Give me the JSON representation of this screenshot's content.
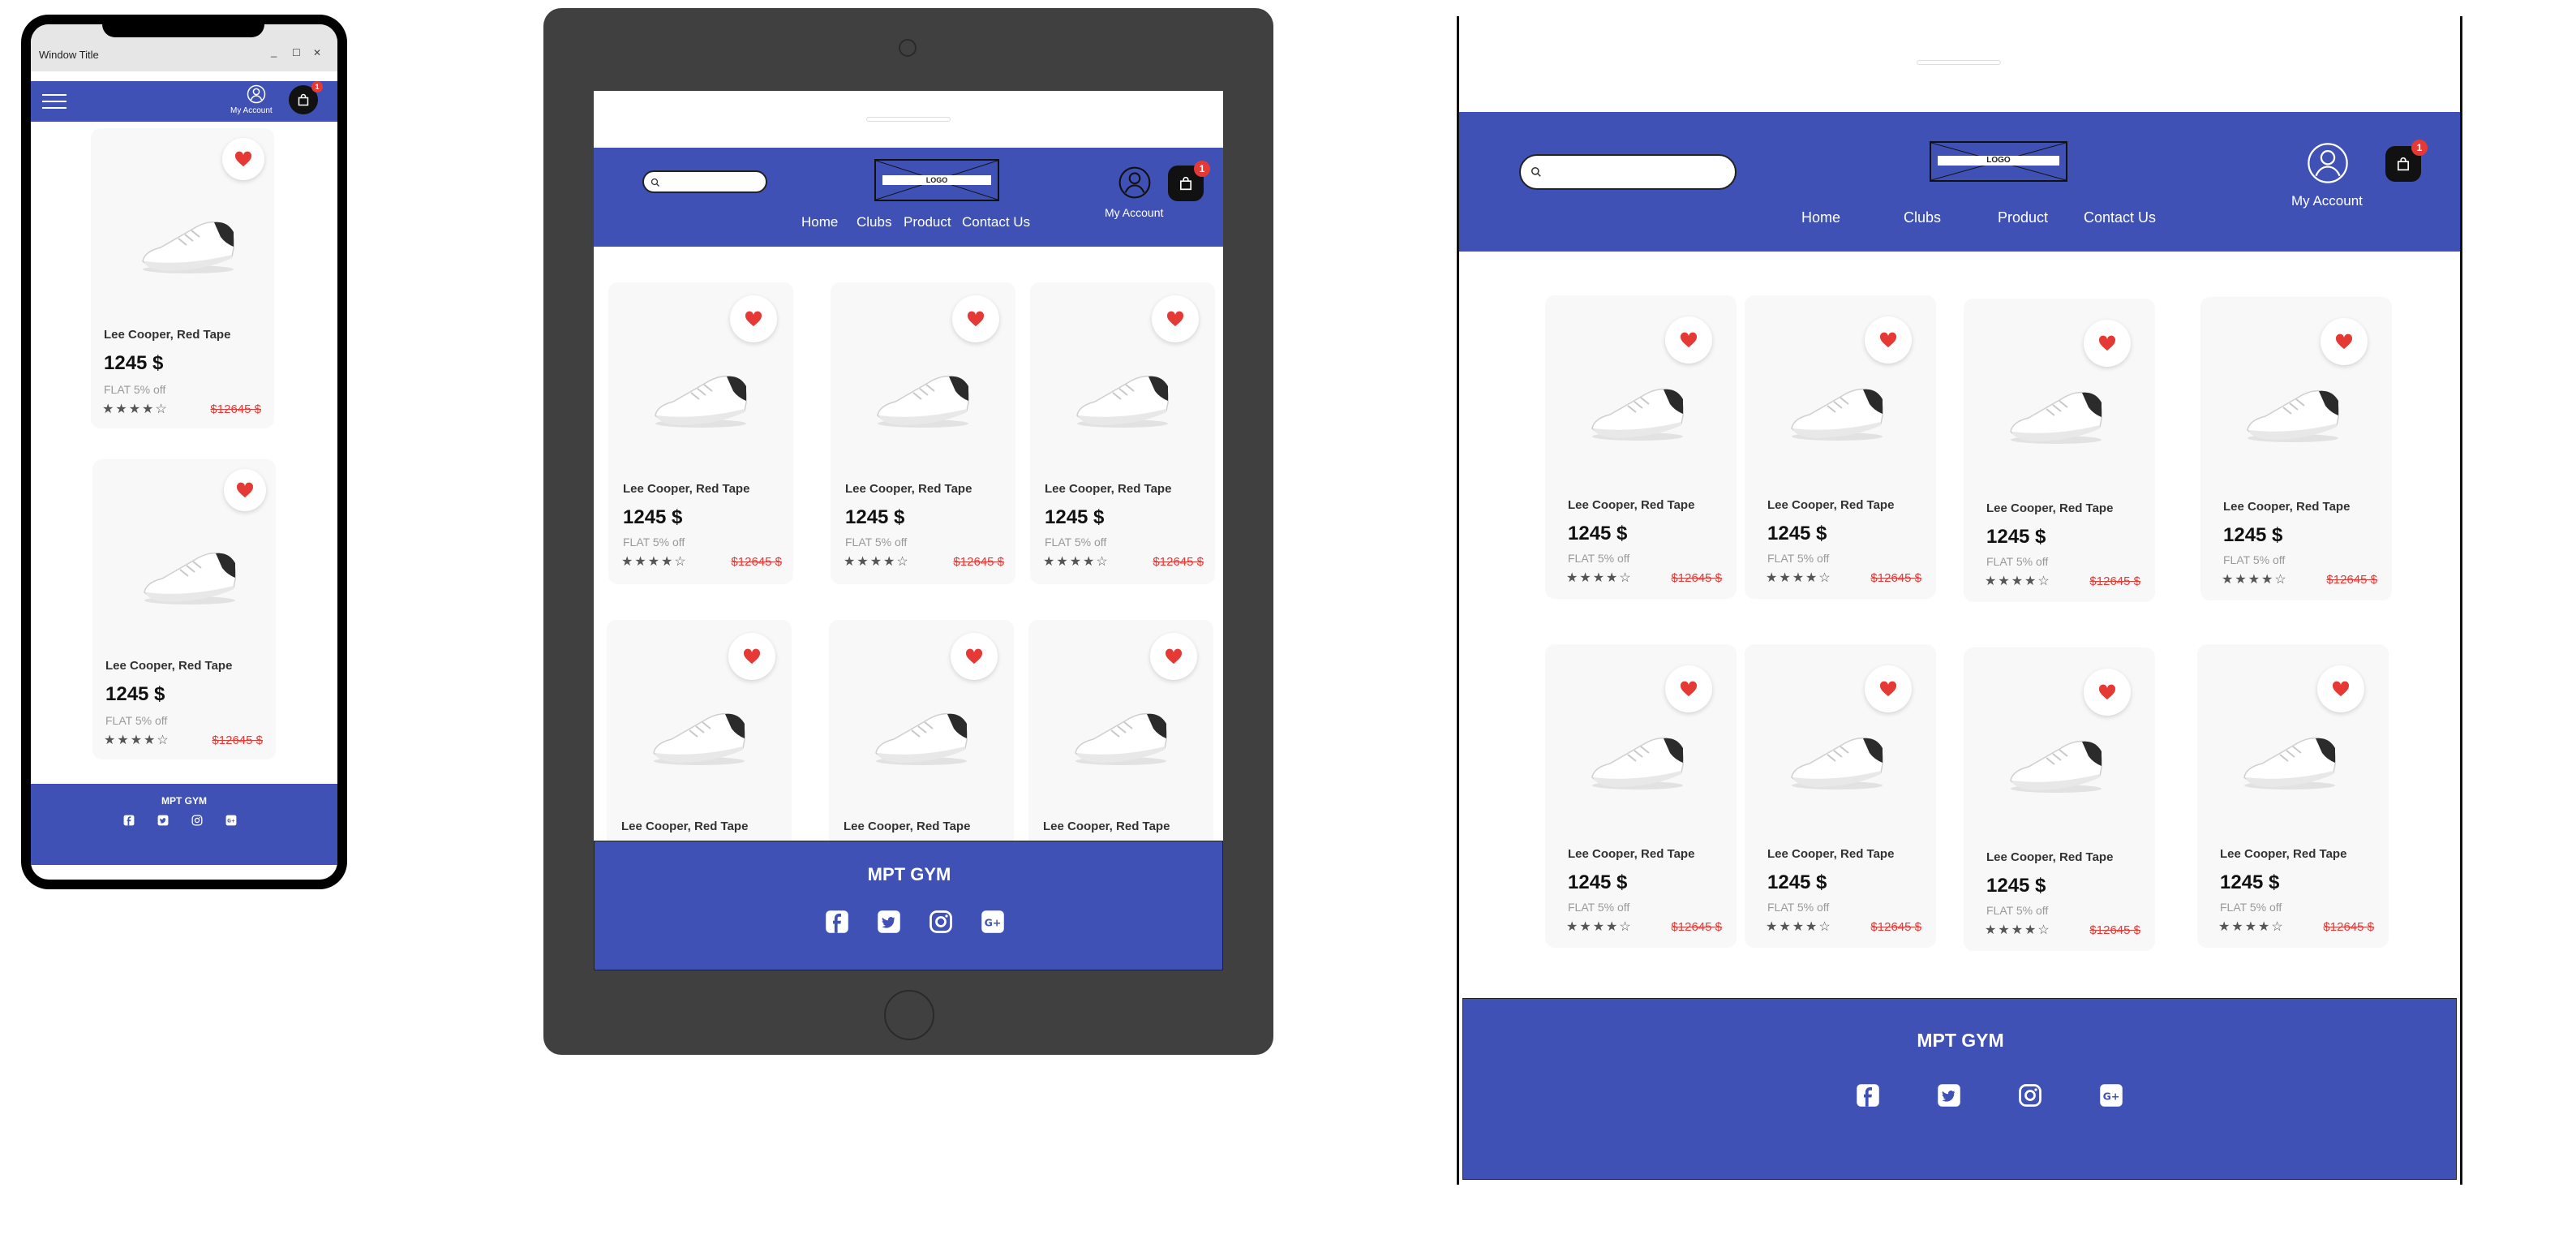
{
  "colors": {
    "brand": "#3f51b5",
    "heart": "#e53935",
    "strike_price": "#e53935",
    "tablet_frame": "#404040"
  },
  "mobile": {
    "window_title": "Window Title",
    "window_controls": [
      "_",
      "☐",
      "✕"
    ],
    "account_label": "My Account",
    "cart_badge": "1",
    "footer_title": "MPT GYM",
    "products": [
      {
        "name": "Lee Cooper, Red Tape",
        "price": "1245 $",
        "offer": "FLAT 5% off",
        "old_price": "$12645 $",
        "rating": 4
      },
      {
        "name": "Lee Cooper, Red Tape",
        "price": "1245 $",
        "offer": "FLAT 5% off",
        "old_price": "$12645 $",
        "rating": 4
      }
    ]
  },
  "tablet": {
    "logo_text": "LOGO",
    "account_label": "My Account",
    "cart_badge": "1",
    "nav": [
      "Home",
      "Clubs",
      "Product",
      "Contact Us"
    ],
    "footer_title": "MPT GYM",
    "products": [
      {
        "name": "Lee Cooper, Red Tape",
        "price": "1245 $",
        "offer": "FLAT 5% off",
        "old_price": "$12645 $",
        "rating": 4
      },
      {
        "name": "Lee Cooper, Red Tape",
        "price": "1245 $",
        "offer": "FLAT 5% off",
        "old_price": "$12645 $",
        "rating": 4
      },
      {
        "name": "Lee Cooper, Red Tape",
        "price": "1245 $",
        "offer": "FLAT 5% off",
        "old_price": "$12645 $",
        "rating": 4
      },
      {
        "name": "Lee Cooper, Red Tape"
      },
      {
        "name": "Lee Cooper, Red Tape"
      },
      {
        "name": "Lee Cooper, Red Tape"
      }
    ]
  },
  "desktop": {
    "logo_text": "LOGO",
    "account_label": "My Account",
    "cart_badge": "1",
    "nav": [
      "Home",
      "Clubs",
      "Product",
      "Contact Us"
    ],
    "footer_title": "MPT GYM",
    "products": [
      {
        "name": "Lee Cooper, Red Tape",
        "price": "1245 $",
        "offer": "FLAT 5% off",
        "old_price": "$12645 $",
        "rating": 4
      },
      {
        "name": "Lee Cooper, Red Tape",
        "price": "1245 $",
        "offer": "FLAT 5% off",
        "old_price": "$12645 $",
        "rating": 4
      },
      {
        "name": "Lee Cooper, Red Tape",
        "price": "1245 $",
        "offer": "FLAT 5% off",
        "old_price": "$12645 $",
        "rating": 4
      },
      {
        "name": "Lee Cooper, Red Tape",
        "price": "1245 $",
        "offer": "FLAT 5% off",
        "old_price": "$12645 $",
        "rating": 4
      },
      {
        "name": "Lee Cooper, Red Tape",
        "price": "1245 $",
        "offer": "FLAT 5% off",
        "old_price": "$12645 $",
        "rating": 4
      },
      {
        "name": "Lee Cooper, Red Tape",
        "price": "1245 $",
        "offer": "FLAT 5% off",
        "old_price": "$12645 $",
        "rating": 4
      },
      {
        "name": "Lee Cooper, Red Tape",
        "price": "1245 $",
        "offer": "FLAT 5% off",
        "old_price": "$12645 $",
        "rating": 4
      },
      {
        "name": "Lee Cooper, Red Tape",
        "price": "1245 $",
        "offer": "FLAT 5% off",
        "old_price": "$12645 $",
        "rating": 4
      }
    ]
  },
  "icons": {
    "social": [
      "facebook-icon",
      "twitter-icon",
      "instagram-icon",
      "google-plus-icon"
    ],
    "glyphs": {
      "star_full": "★",
      "star_empty": "☆",
      "google_plus": "G+"
    }
  }
}
